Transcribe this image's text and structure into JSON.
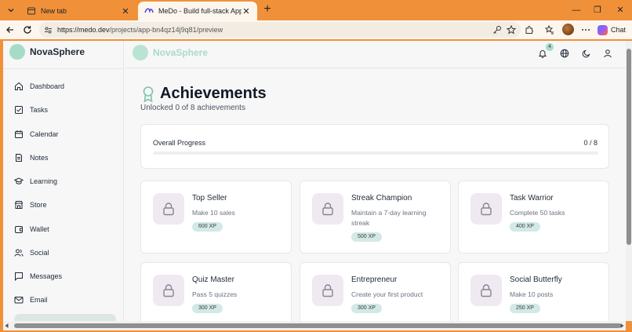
{
  "browser": {
    "tabs": [
      {
        "title": "New tab",
        "icon": "page-icon",
        "active": false
      },
      {
        "title": "MeDo - Build full-stack Apps With",
        "icon": "medo-favicon",
        "active": true
      }
    ],
    "url_domain": "https://medo.dev",
    "url_path": "/projects/app-bn4qz14j9q81/preview",
    "chat_label": "Chat"
  },
  "app": {
    "brand": "NovaSphere",
    "notification_count": "4"
  },
  "sidebar": {
    "items": [
      {
        "label": "Dashboard",
        "icon": "home-icon"
      },
      {
        "label": "Tasks",
        "icon": "checkbox-icon"
      },
      {
        "label": "Calendar",
        "icon": "calendar-icon"
      },
      {
        "label": "Notes",
        "icon": "document-icon"
      },
      {
        "label": "Learning",
        "icon": "graduation-cap-icon"
      },
      {
        "label": "Store",
        "icon": "store-icon"
      },
      {
        "label": "Wallet",
        "icon": "wallet-icon"
      },
      {
        "label": "Social",
        "icon": "users-icon"
      },
      {
        "label": "Messages",
        "icon": "message-icon"
      },
      {
        "label": "Email",
        "icon": "mail-icon"
      }
    ]
  },
  "page": {
    "title": "Achievements",
    "subtitle": "Unlocked 0 of 8 achievements",
    "progress_label": "Overall Progress",
    "progress_count": "0 / 8",
    "progress_fraction": 0
  },
  "achievements": [
    {
      "title": "Top Seller",
      "desc": "Make 10 sales",
      "xp": "600 XP"
    },
    {
      "title": "Streak Champion",
      "desc": "Maintain a 7-day learning streak",
      "xp": "500 XP"
    },
    {
      "title": "Task Warrior",
      "desc": "Complete 50 tasks",
      "xp": "400 XP"
    },
    {
      "title": "Quiz Master",
      "desc": "Pass 5 quizzes",
      "xp": "300 XP"
    },
    {
      "title": "Entrepreneur",
      "desc": "Create your first product",
      "xp": "300 XP"
    },
    {
      "title": "Social Butterfly",
      "desc": "Make 10 posts",
      "xp": "250 XP"
    }
  ],
  "colors": {
    "browser_frame": "#f0913a",
    "accent": "#a6dcc7",
    "lock_bg": "#efe9f1",
    "xp_badge": "#d3e9e3"
  }
}
